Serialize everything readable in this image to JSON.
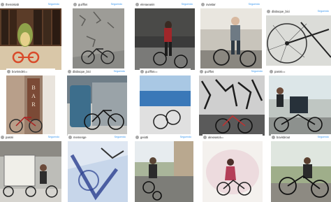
{
  "follow_label": "Seguendo",
  "more_label": "•••",
  "posts": [
    {
      "user": "thenoisiab"
    },
    {
      "user": "gui/lfos"
    },
    {
      "user": "elenaeanin"
    },
    {
      "user": "ovastar"
    },
    {
      "user": "dlaboque_bici"
    },
    {
      "user": "bovinndel"
    },
    {
      "user": "dlaboque_bici"
    },
    {
      "user": "gui/lfos"
    },
    {
      "user": "gui/lfos"
    },
    {
      "user": "pasmi"
    },
    {
      "user": "pasmi"
    },
    {
      "user": "memenge"
    },
    {
      "user": "geiotti"
    },
    {
      "user": "alexeasol"
    },
    {
      "user": "bovisbrout"
    }
  ],
  "photo_text": {
    "bar_sign": "BAR"
  }
}
